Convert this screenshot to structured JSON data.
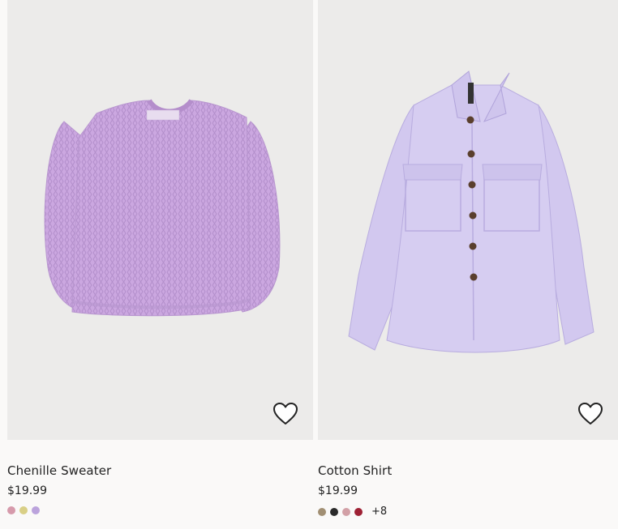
{
  "products": [
    {
      "name": "Chenille Sweater",
      "price": "$19.99",
      "swatch_colors": [
        "#d69aab",
        "#d9cf86",
        "#bba3dc"
      ],
      "more_colors": "",
      "favorite_icon": "heart-outline-icon"
    },
    {
      "name": "Cotton Shirt",
      "price": "$19.99",
      "swatch_colors": [
        "#a18f73",
        "#2a2a2a",
        "#d2a0a6",
        "#9e2134"
      ],
      "more_colors": "+8",
      "favorite_icon": "heart-outline-icon"
    }
  ],
  "colors": {
    "page_background": "#faf9f8",
    "image_background": "#ecebea",
    "sweater": "#cba7e0",
    "shirt": "#d2c8ef"
  }
}
